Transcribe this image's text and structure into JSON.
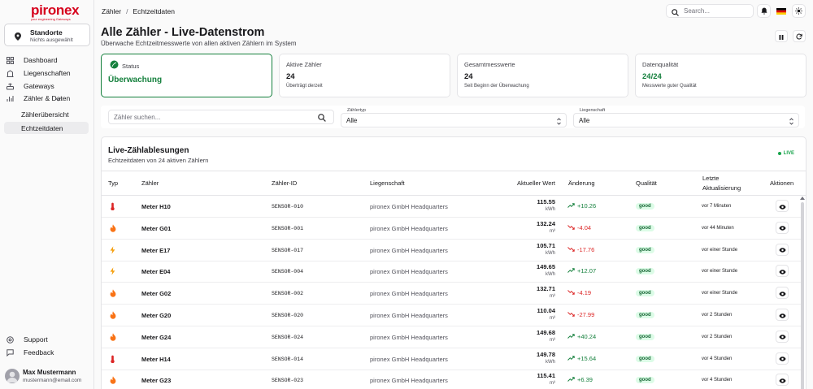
{
  "brand": {
    "name": "pironex",
    "tagline": "your engineering Gateways",
    "color": "#d6001c"
  },
  "site_selector": {
    "title": "Standorte",
    "subtitle": "Nichts ausgewählt"
  },
  "sidebar": {
    "items": [
      {
        "label": "Dashboard",
        "icon": "dashboard-icon"
      },
      {
        "label": "Liegenschaften",
        "icon": "building-icon"
      },
      {
        "label": "Gateways",
        "icon": "gateway-icon"
      },
      {
        "label": "Zähler & Daten",
        "icon": "meter-icon"
      },
      {
        "label": "Zählerübersicht"
      },
      {
        "label": "Echtzeitdaten"
      }
    ],
    "footer": [
      {
        "label": "Support",
        "icon": "help-icon"
      },
      {
        "label": "Feedback",
        "icon": "message-icon"
      }
    ]
  },
  "user": {
    "name": "Max Mustermann",
    "email": "mustermann@email.com"
  },
  "breadcrumb": {
    "parent": "Zähler",
    "separator": "/",
    "current": "Echtzeitdaten"
  },
  "search": {
    "placeholder": "Search..."
  },
  "page": {
    "title": "Alle Zähler - Live-Datenstrom",
    "subtitle": "Überwache Echtzeitmesswerte von allen aktiven Zählern im System"
  },
  "cards": {
    "status": {
      "label": "Status",
      "value": "Überwachung"
    },
    "active": {
      "label": "Aktive Zähler",
      "value": "24",
      "desc": "Überträgt derzeit"
    },
    "total": {
      "label": "Gesamtmesswerte",
      "value": "24",
      "desc": "Seit Beginn der Überwachung"
    },
    "quality": {
      "label": "Datenqualität",
      "value": "24/24",
      "desc": "Messwerte guter Qualität"
    }
  },
  "filters": {
    "search_placeholder": "Zähler suchen...",
    "type_label": "Zählertyp",
    "type_value": "Alle",
    "property_label": "Liegenschaft",
    "property_value": "Alle"
  },
  "table": {
    "title": "Live-Zählablesungen",
    "subtitle": "Echtzeitdaten von 24 aktiven Zählern",
    "live_label": "LIVE",
    "columns": {
      "typ": "Typ",
      "name": "Zähler",
      "id": "Zähler-ID",
      "property": "Liegenschaft",
      "value": "Aktueller Wert",
      "change": "Änderung",
      "quality": "Qualität",
      "updated_1": "Letzte",
      "updated_2": "Aktualisierung",
      "actions": "Aktionen"
    },
    "rows": [
      {
        "type": "thermometer-icon",
        "name": "Meter H10",
        "id": "SENSOR-010",
        "property": "pironex GmbH Headquarters",
        "value": "115.55",
        "unit": "kWh",
        "change": "+10.26",
        "dir": "up",
        "quality": "good",
        "updated": "vor 7 Minuten"
      },
      {
        "type": "flame-icon",
        "name": "Meter G01",
        "id": "SENSOR-001",
        "property": "pironex GmbH Headquarters",
        "value": "132.24",
        "unit": "m³",
        "change": "-4.04",
        "dir": "down",
        "quality": "good",
        "updated": "vor 44 Minuten"
      },
      {
        "type": "bolt-icon",
        "name": "Meter E17",
        "id": "SENSOR-017",
        "property": "pironex GmbH Headquarters",
        "value": "105.71",
        "unit": "kWh",
        "change": "-17.76",
        "dir": "down",
        "quality": "good",
        "updated": "vor einer Stunde"
      },
      {
        "type": "bolt-icon",
        "name": "Meter E04",
        "id": "SENSOR-004",
        "property": "pironex GmbH Headquarters",
        "value": "149.65",
        "unit": "kWh",
        "change": "+12.07",
        "dir": "up",
        "quality": "good",
        "updated": "vor einer Stunde"
      },
      {
        "type": "flame-icon",
        "name": "Meter G02",
        "id": "SENSOR-002",
        "property": "pironex GmbH Headquarters",
        "value": "132.71",
        "unit": "m³",
        "change": "-4.19",
        "dir": "down",
        "quality": "good",
        "updated": "vor einer Stunde"
      },
      {
        "type": "flame-icon",
        "name": "Meter G20",
        "id": "SENSOR-020",
        "property": "pironex GmbH Headquarters",
        "value": "110.04",
        "unit": "m³",
        "change": "-27.99",
        "dir": "down",
        "quality": "good",
        "updated": "vor 2 Stunden"
      },
      {
        "type": "flame-icon",
        "name": "Meter G24",
        "id": "SENSOR-024",
        "property": "pironex GmbH Headquarters",
        "value": "149.68",
        "unit": "m³",
        "change": "+40.24",
        "dir": "up",
        "quality": "good",
        "updated": "vor 2 Stunden"
      },
      {
        "type": "thermometer-icon",
        "name": "Meter H14",
        "id": "SENSOR-014",
        "property": "pironex GmbH Headquarters",
        "value": "149.78",
        "unit": "kWh",
        "change": "+15.64",
        "dir": "up",
        "quality": "good",
        "updated": "vor 4 Stunden"
      },
      {
        "type": "flame-icon",
        "name": "Meter G23",
        "id": "SENSOR-023",
        "property": "pironex GmbH Headquarters",
        "value": "115.41",
        "unit": "m³",
        "change": "+6.39",
        "dir": "up",
        "quality": "good",
        "updated": "vor 4 Stunden"
      }
    ]
  }
}
